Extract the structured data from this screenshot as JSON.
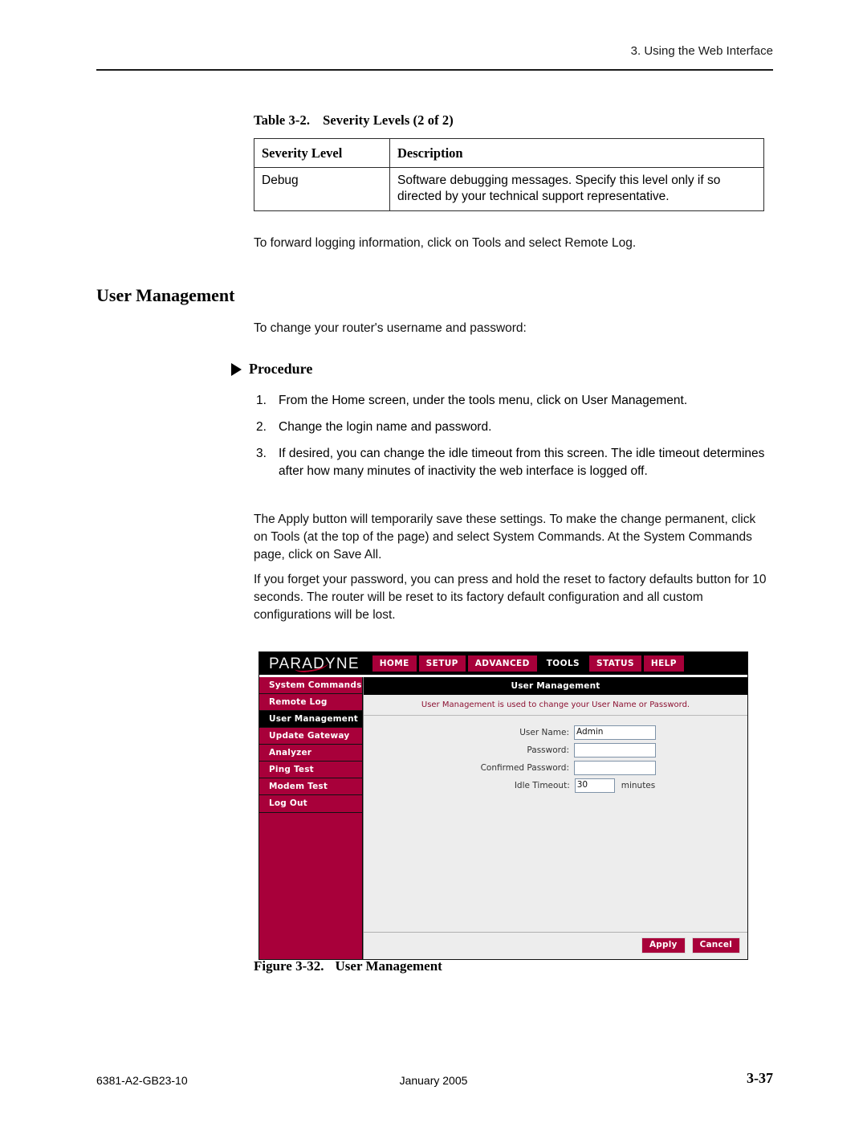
{
  "header": {
    "running_head": "3. Using the Web Interface"
  },
  "table": {
    "caption_number": "Table 3-2.",
    "caption_text": "Severity Levels (2 of 2)",
    "columns": [
      "Severity Level",
      "Description"
    ],
    "rows": [
      {
        "level": "Debug",
        "description": "Software debugging messages. Specify this level only if so directed by your technical support representative."
      }
    ]
  },
  "body": {
    "forward_logging": "To forward logging information, click on Tools and select Remote Log.",
    "section_heading": "User Management",
    "change_intro": "To change your router's username and password:",
    "procedure_label": "Procedure",
    "steps": [
      {
        "num": "1.",
        "text": "From the Home screen, under the tools menu, click on User Management."
      },
      {
        "num": "2.",
        "text": "Change the login name and password."
      },
      {
        "num": "3.",
        "text": "If desired, you can change the idle timeout from this screen. The idle timeout determines after how many minutes of inactivity the web interface is logged off."
      }
    ],
    "apply_note": "The Apply button will temporarily save these settings. To make the change permanent,  click on Tools (at the top of the page) and select System Commands. At the System Commands page, click on Save All.",
    "forgot_note": "If you forget your password, you can press and hold the reset to factory defaults button for 10 seconds. The router will be reset to its factory default configuration and all custom configurations will be lost."
  },
  "figure": {
    "caption_number": "Figure 3-32.",
    "caption_text": "User Management",
    "screenshot": {
      "brand": "PARADYNE",
      "colors": {
        "crimson": "#a8003a",
        "active_tab": "#000000",
        "panel_bg": "#ededed",
        "subtitle_text": "#8d1233"
      },
      "tabs": [
        {
          "label": "HOME",
          "active": false
        },
        {
          "label": "SETUP",
          "active": false
        },
        {
          "label": "ADVANCED",
          "active": false
        },
        {
          "label": "TOOLS",
          "active": true
        },
        {
          "label": "STATUS",
          "active": false
        },
        {
          "label": "HELP",
          "active": false
        }
      ],
      "sidebar": [
        {
          "label": "System Commands",
          "active": false
        },
        {
          "label": "Remote Log",
          "active": false
        },
        {
          "label": "User Management",
          "active": true
        },
        {
          "label": "Update Gateway",
          "active": false
        },
        {
          "label": "Analyzer",
          "active": false
        },
        {
          "label": "Ping Test",
          "active": false
        },
        {
          "label": "Modem Test",
          "active": false
        },
        {
          "label": "Log Out",
          "active": false
        }
      ],
      "panel_title": "User Management",
      "panel_subtitle": "User Management is used to change your User Name or Password.",
      "fields": [
        {
          "label": "User Name:",
          "value": "Admin",
          "unit": ""
        },
        {
          "label": "Password:",
          "value": "",
          "unit": ""
        },
        {
          "label": "Confirmed Password:",
          "value": "",
          "unit": ""
        },
        {
          "label": "Idle Timeout:",
          "value": "30",
          "unit": "minutes"
        }
      ],
      "buttons": [
        {
          "label": "Apply"
        },
        {
          "label": "Cancel"
        }
      ]
    }
  },
  "footer": {
    "document_number": "6381-A2-GB23-10",
    "date": "January 2005",
    "page_number": "3-37"
  }
}
